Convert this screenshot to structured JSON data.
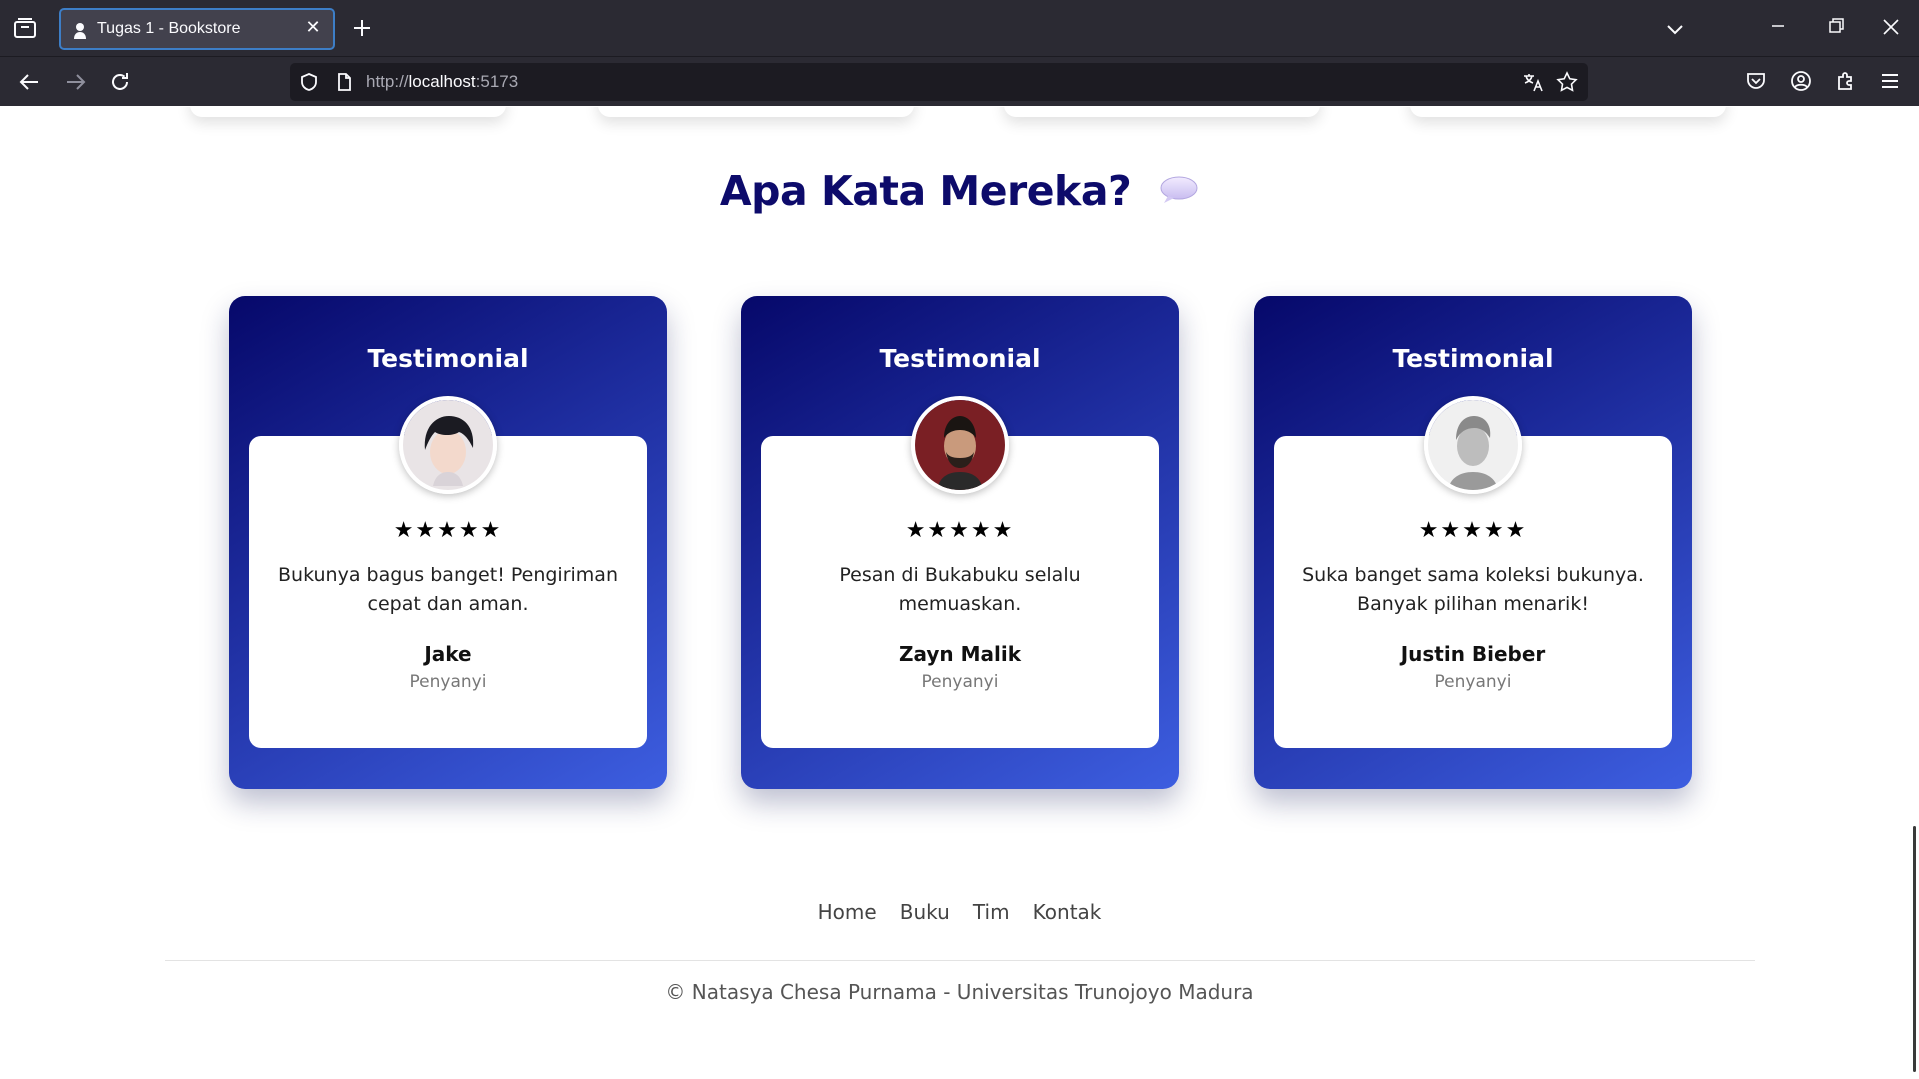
{
  "browser": {
    "tab_title": "Tugas 1 - Bookstore",
    "url_prefix": "http://",
    "url_host": "localhost",
    "url_port": ":5173"
  },
  "section": {
    "title": "Apa Kata Mereka?"
  },
  "testimonials": [
    {
      "heading": "Testimonial",
      "stars": "★★★★★",
      "quote": "Bukunya bagus banget! Pengiriman cepat dan aman.",
      "name": "Jake",
      "role": "Penyanyi"
    },
    {
      "heading": "Testimonial",
      "stars": "★★★★★",
      "quote": "Pesan di Bukabuku selalu memuaskan.",
      "name": "Zayn Malik",
      "role": "Penyanyi"
    },
    {
      "heading": "Testimonial",
      "stars": "★★★★★",
      "quote": "Suka banget sama koleksi bukunya. Banyak pilihan menarik!",
      "name": "Justin Bieber",
      "role": "Penyanyi"
    }
  ],
  "footer": {
    "links": [
      "Home",
      "Buku",
      "Tim",
      "Kontak"
    ],
    "copyright": "© Natasya Chesa Purnama - Universitas Trunojoyo Madura"
  },
  "colors": {
    "title": "#0d0b6b",
    "card_gradient_start": "#06086a",
    "card_gradient_end": "#3d5ee0"
  }
}
